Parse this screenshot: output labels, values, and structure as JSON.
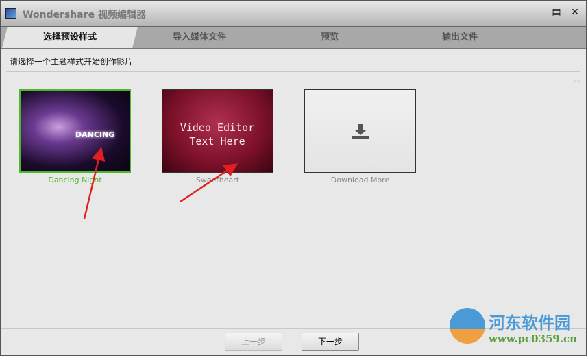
{
  "window": {
    "title": "Wondershare 视频编辑器",
    "menu_icon": "menu-icon",
    "close_icon": "close-icon"
  },
  "tabs": [
    {
      "label": "选择预设样式",
      "active": true
    },
    {
      "label": "导入媒体文件"
    },
    {
      "label": "预览"
    },
    {
      "label": "输出文件"
    }
  ],
  "instruction": "请选择一个主题样式开始创作影片",
  "themes": [
    {
      "label": "Dancing Night",
      "selected": true,
      "thumb_text": "DANCING"
    },
    {
      "label": "Sweetheart",
      "thumb_text": "Video Editor Text Here"
    },
    {
      "label": "Download More",
      "icon": "download-icon"
    }
  ],
  "colors": {
    "selected": "#4cb82c",
    "arrow": "#e02020"
  },
  "buttons": {
    "prev": "上一步",
    "next": "下一步"
  },
  "watermark": {
    "name": "河东软件园",
    "url": "www.pc0359.cn"
  }
}
